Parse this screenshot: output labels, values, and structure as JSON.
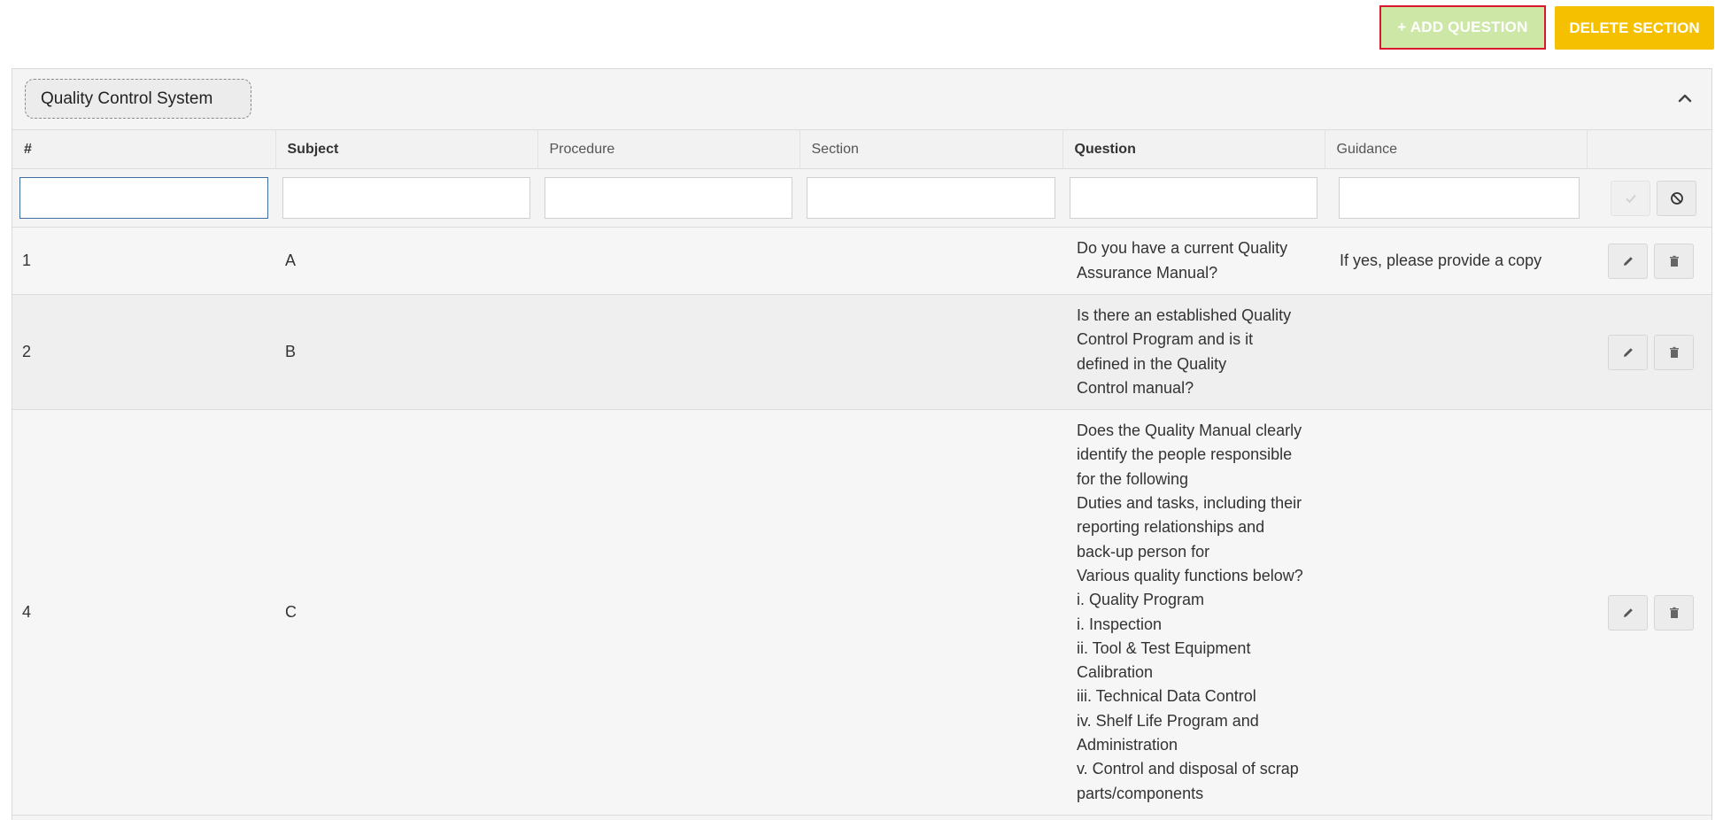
{
  "toolbar": {
    "add_question_label": "+ ADD QUESTION",
    "delete_section_label": "DELETE SECTION"
  },
  "section": {
    "title": "Quality Control System"
  },
  "table": {
    "columns": [
      "#",
      "Subject",
      "Procedure",
      "Section",
      "Question",
      "Guidance"
    ],
    "rows": [
      {
        "number": "1",
        "subject": "A",
        "procedure": "",
        "section": "",
        "question_lines": [
          "Do you have a current Quality",
          "Assurance Manual?"
        ],
        "guidance": "If yes, please provide a copy"
      },
      {
        "number": "2",
        "subject": "B",
        "procedure": "",
        "section": "",
        "question_lines": [
          "Is there an established Quality",
          "Control Program and is it",
          "defined in the Quality",
          "Control manual?"
        ],
        "guidance": ""
      },
      {
        "number": "4",
        "subject": "C",
        "procedure": "",
        "section": "",
        "question_lines": [
          "Does the Quality Manual clearly",
          "identify the people responsible",
          "for the following",
          "Duties and tasks, including their",
          "reporting relationships and",
          "back-up person for",
          "Various quality functions below?",
          "i. Quality Program",
          "i. Inspection",
          "ii. Tool & Test Equipment",
          "Calibration",
          "iii. Technical Data Control",
          "iv. Shelf Life Program and",
          "Administration",
          "v. Control and disposal of scrap",
          "parts/components"
        ],
        "guidance": ""
      }
    ]
  },
  "icons": {
    "collapse": "chevron-up-icon",
    "confirm": "check-icon",
    "cancel": "ban-icon",
    "edit": "pencil-icon",
    "delete": "trash-icon"
  },
  "colors": {
    "add_button": "#cde8a6",
    "delete_button": "#f5c000",
    "highlight_border": "#d9182d"
  }
}
